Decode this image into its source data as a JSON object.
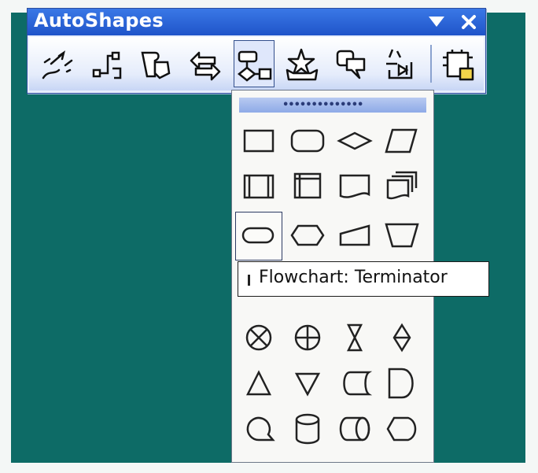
{
  "window": {
    "title": "AutoShapes"
  },
  "toolbar": {
    "buttons": [
      {
        "id": "lines",
        "name": "Lines"
      },
      {
        "id": "connectors",
        "name": "Connectors"
      },
      {
        "id": "basic-shapes",
        "name": "Basic Shapes"
      },
      {
        "id": "block-arrows",
        "name": "Block Arrows"
      },
      {
        "id": "flowchart",
        "name": "Flowchart",
        "pressed": true
      },
      {
        "id": "stars-banners",
        "name": "Stars and Banners"
      },
      {
        "id": "callouts",
        "name": "Callouts"
      },
      {
        "id": "action-buttons",
        "name": "Action Buttons"
      },
      {
        "id": "more-autoshapes",
        "name": "More AutoShapes"
      }
    ]
  },
  "flowchart_menu": {
    "tooltip": "Flowchart: Terminator",
    "hovered_shape": "terminator",
    "shapes": [
      "process",
      "alternate-process",
      "decision",
      "data",
      "predefined-process",
      "internal-storage",
      "document",
      "multidocument",
      "terminator",
      "preparation",
      "manual-input",
      "manual-operation",
      "summing-junction",
      "or",
      "collate",
      "sort",
      "extract",
      "merge",
      "stored-data",
      "delay",
      "sequential-access-storage",
      "magnetic-disk",
      "direct-access-storage",
      "display"
    ]
  },
  "colors": {
    "background": "#0d6b66",
    "titlebar": "#1f54c9",
    "toolbar": "#e8eefc",
    "menu": "#f8f8f6"
  }
}
